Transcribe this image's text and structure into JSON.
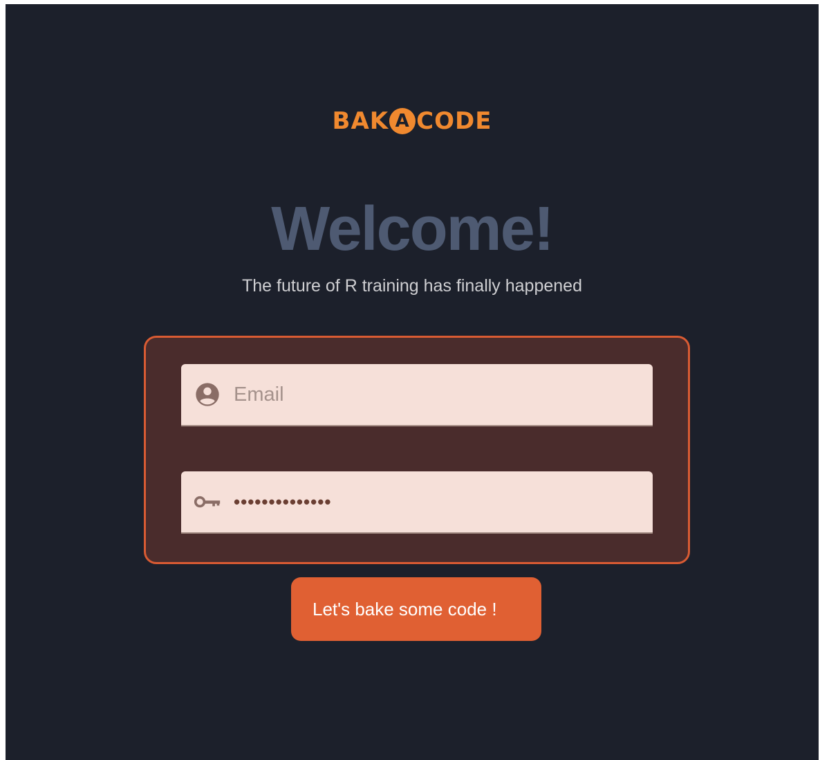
{
  "logo": {
    "left_text": "BAK",
    "circle_letter": "A",
    "right_text": "CODE"
  },
  "hero": {
    "title": "Welcome!",
    "subtitle": "The future of R training has finally happened"
  },
  "form": {
    "email": {
      "icon": "account-circle-icon",
      "placeholder": "Email",
      "value": ""
    },
    "password": {
      "icon": "key-icon",
      "masked_value": "••••••••••••••"
    }
  },
  "submit": {
    "label": "Let's bake some code !"
  },
  "colors": {
    "background": "#1c202b",
    "accent": "#e06033",
    "logo": "#f0892f",
    "panel": "#4a2c2c",
    "panel_border": "#d95b33",
    "field": "#f6e0d9",
    "title": "#4e5a72"
  }
}
